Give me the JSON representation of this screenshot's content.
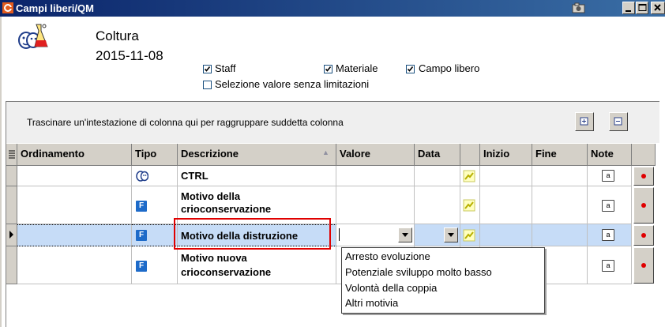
{
  "window": {
    "title": "Campi liberi/QM",
    "camera_icon": "camera-icon",
    "controls": [
      "minimize",
      "maximize",
      "close"
    ]
  },
  "header": {
    "label": "Coltura",
    "date": "2015-11-08",
    "icon": "culture-people-flask-icon"
  },
  "filters": {
    "staff": {
      "label": "Staff",
      "checked": true
    },
    "materiale": {
      "label": "Materiale",
      "checked": true
    },
    "campo_libero": {
      "label": "Campo libero",
      "checked": true
    },
    "selezione": {
      "label": "Selezione valore senza limitazioni",
      "checked": false
    }
  },
  "grid": {
    "group_hint": "Trascinare un'intestazione di colonna qui per raggruppare suddetta colonna",
    "expand_icon": "plus-box-icon",
    "collapse_icon": "minus-box-icon",
    "columns": [
      "Ordinamento",
      "Tipo",
      "Descrizione",
      "Valore",
      "Data",
      "",
      "Inizio",
      "Fine",
      "Note",
      ""
    ],
    "sort_column": "Descrizione",
    "rows": [
      {
        "ordinamento": "",
        "tipo": "people-icon",
        "descrizione_l1": "CTRL",
        "descrizione_l2": "",
        "selected": false
      },
      {
        "ordinamento": "",
        "tipo": "F",
        "descrizione_l1": "Motivo della",
        "descrizione_l2": "crioconservazione",
        "selected": false
      },
      {
        "ordinamento": "",
        "tipo": "F",
        "descrizione_l1": "Motivo della distruzione",
        "descrizione_l2": "",
        "selected": true
      },
      {
        "ordinamento": "",
        "tipo": "F",
        "descrizione_l1": "Motivo nuova",
        "descrizione_l2": "crioconservazione",
        "selected": false
      }
    ]
  },
  "dropdown": {
    "options": [
      "Arresto evoluzione",
      "Potenziale sviluppo molto basso",
      "Volontà della coppia",
      "Altri motivia"
    ]
  },
  "colors": {
    "titlebar": "#0a246a",
    "selected_row": "#c6dcf7",
    "highlight_box": "#e00000",
    "type_icon_blue": "#1e6bc9"
  }
}
